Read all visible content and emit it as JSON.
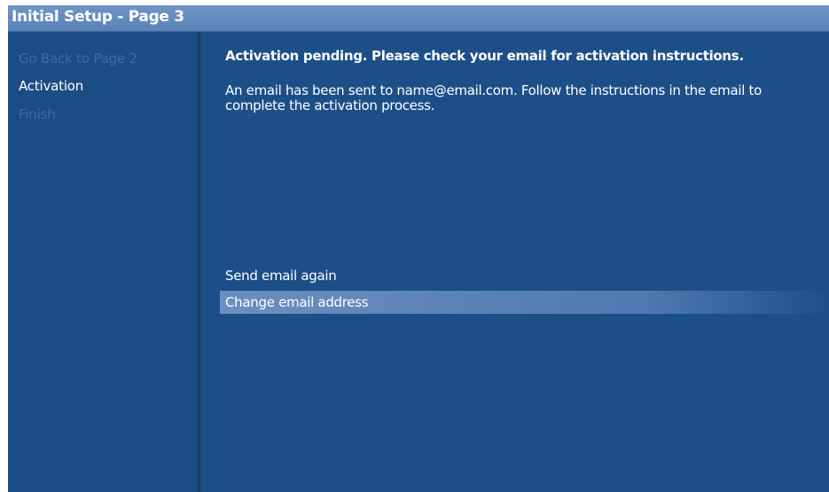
{
  "window": {
    "title": "Initial Setup - Page 3"
  },
  "sidebar": {
    "items": [
      {
        "label": "Go Back to Page 2",
        "state": "dim"
      },
      {
        "label": "Activation",
        "state": "active"
      },
      {
        "label": "Finish",
        "state": "dim"
      }
    ]
  },
  "main": {
    "heading": "Activation pending. Please check your email for activation instructions.",
    "message": "An email has been sent to name@email.com. Follow the instructions in the email to complete the activation process.",
    "options": [
      {
        "label": "Send email again",
        "selected": false
      },
      {
        "label": "Change email address",
        "selected": true
      }
    ]
  },
  "colors": {
    "background": "#1c4f88",
    "title_bar": "#5f88bd",
    "selection": "#6b8fc2",
    "dim_text": "#3e6c9f",
    "text": "#ffffff"
  }
}
